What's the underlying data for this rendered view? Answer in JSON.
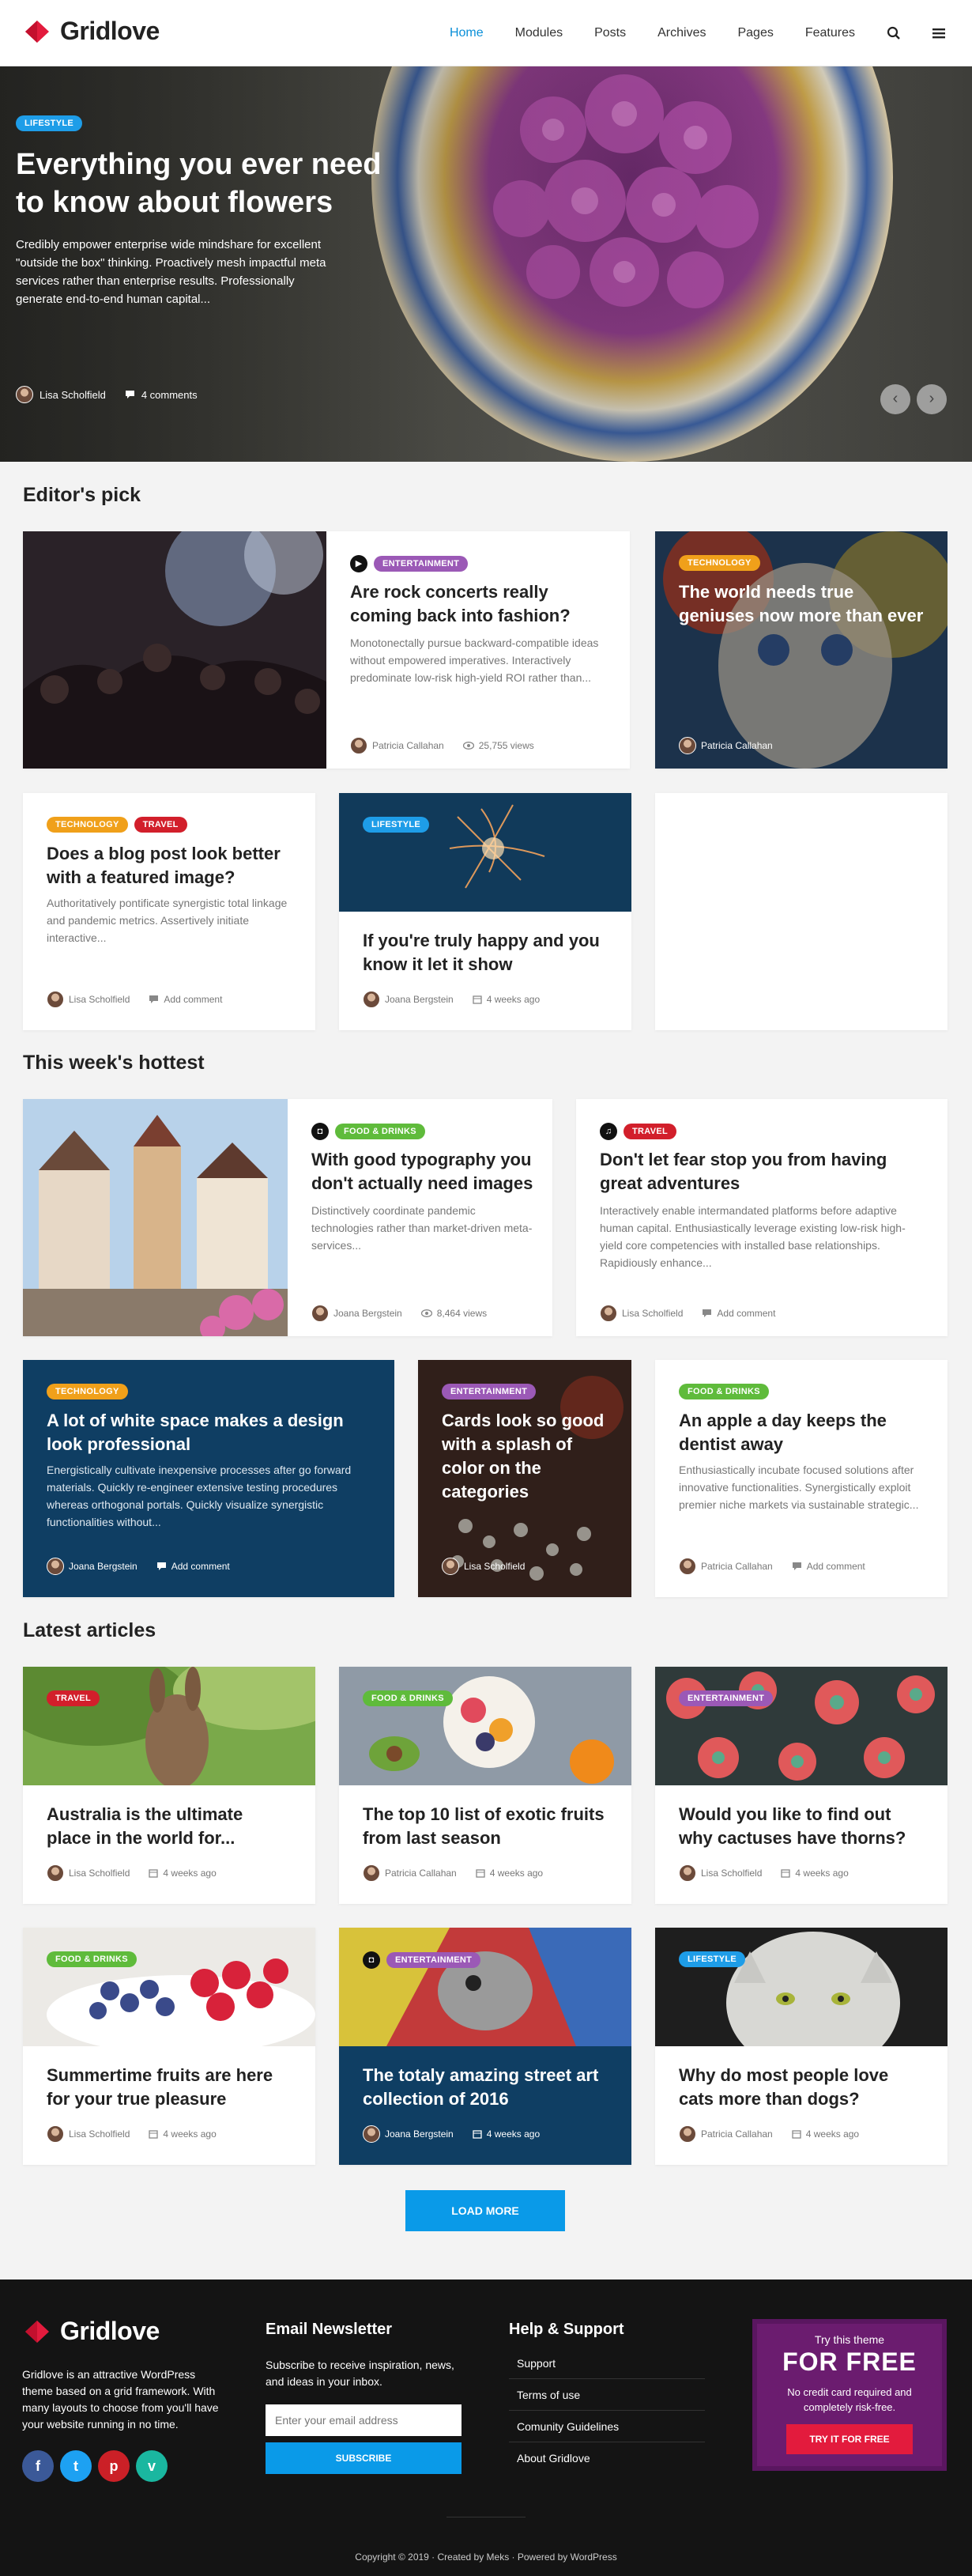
{
  "brand": {
    "name": "Gridlove",
    "accent": "#e31b3d",
    "link": "#0a8fd8"
  },
  "nav": {
    "items": [
      "Home",
      "Modules",
      "Posts",
      "Archives",
      "Pages",
      "Features"
    ]
  },
  "hero": {
    "category": "Lifestyle",
    "title": "Everything you ever need to know about flowers",
    "excerpt": "Credibly empower enterprise wide mindshare for excellent \"outside the box\" thinking. Proactively mesh impactful meta services rather than enterprise results. Professionally generate end-to-end human capital...",
    "author": "Lisa Scholfield",
    "comments": "4 comments"
  },
  "editors": {
    "title": "Editor's pick",
    "c1": {
      "category": "Entertainment",
      "title": "Are rock concerts really coming back into fashion?",
      "excerpt": "Monotonectally pursue backward-compatible ideas without empowered imperatives. Interactively predominate low-risk high-yield ROI rather than...",
      "author": "Patricia Callahan",
      "views": "25,755 views"
    },
    "c2": {
      "category": "Technology",
      "title": "The world needs true geniuses now more than ever",
      "author": "Patricia Callahan"
    },
    "c3": {
      "category1": "Technology",
      "category2": "Travel",
      "title": "Does a blog post look better with a featured image?",
      "excerpt": "Authoritatively pontificate synergistic total linkage and pandemic metrics. Assertively initiate interactive...",
      "author": "Lisa Scholfield",
      "comments": "Add comment"
    },
    "c4": {
      "category": "Lifestyle",
      "title": "If you're truly happy and you know it let it show",
      "author": "Joana Bergstein",
      "time": "4 weeks ago"
    }
  },
  "hottest": {
    "title": "This week's hottest",
    "c1": {
      "category": "Food & Drinks",
      "title": "With good typography you don't actually need images",
      "excerpt": "Distinctively coordinate pandemic technologies rather than market-driven meta-services...",
      "author": "Joana Bergstein",
      "views": "8,464 views"
    },
    "c2": {
      "category": "Travel",
      "title": "Don't let fear stop you from having great adventures",
      "excerpt": "Interactively enable intermandated platforms before adaptive human capital. Enthusiastically leverage existing low-risk high-yield core competencies with installed base relationships. Rapidiously enhance...",
      "author": "Lisa Scholfield",
      "comments": "Add comment"
    },
    "c3": {
      "category": "Technology",
      "title": "A lot of white space makes a design look professional",
      "excerpt": "Energistically cultivate inexpensive processes after go forward materials. Quickly re-engineer extensive testing procedures whereas orthogonal portals. Quickly visualize synergistic functionalities without...",
      "author": "Joana Bergstein",
      "comments": "Add comment"
    },
    "c4": {
      "category": "Entertainment",
      "title": "Cards look so good with a splash of color on the categories",
      "author": "Lisa Scholfield"
    },
    "c5": {
      "category": "Food & Drinks",
      "title": "An apple a day keeps the dentist away",
      "excerpt": "Enthusiastically incubate focused solutions after innovative functionalities. Synergistically exploit premier niche markets via sustainable strategic...",
      "author": "Patricia Callahan",
      "comments": "Add comment"
    }
  },
  "latest": {
    "title": "Latest articles",
    "items": [
      {
        "category": "Travel",
        "title": "Australia is the ultimate place in the world for...",
        "author": "Lisa Scholfield",
        "time": "4 weeks ago"
      },
      {
        "category": "Food & Drinks",
        "title": "The top 10 list of exotic fruits from last season",
        "author": "Patricia Callahan",
        "time": "4 weeks ago"
      },
      {
        "category": "Entertainment",
        "title": "Would you like to find out why cactuses have thorns?",
        "author": "Lisa Scholfield",
        "time": "4 weeks ago"
      },
      {
        "category": "Food & Drinks",
        "title": "Summertime fruits are here for your true pleasure",
        "author": "Lisa Scholfield",
        "time": "4 weeks ago"
      },
      {
        "category": "Entertainment",
        "title": "The totaly amazing street art collection of 2016",
        "author": "Joana Bergstein",
        "time": "4 weeks ago"
      },
      {
        "category": "Lifestyle",
        "title": "Why do most people love cats more than dogs?",
        "author": "Patricia Callahan",
        "time": "4 weeks ago"
      }
    ],
    "load_more": "LOAD MORE"
  },
  "footer": {
    "brand": "Gridlove",
    "desc": "Gridlove is an attractive WordPress theme based on a grid framework. With many layouts to choose from you'll have your website running in no time.",
    "newsletter": {
      "title": "Email Newsletter",
      "text": "Subscribe to receive inspiration, news, and ideas in your inbox.",
      "placeholder": "Enter your email address",
      "button": "SUBSCRIBE"
    },
    "help": {
      "title": "Help & Support",
      "links": [
        "Support",
        "Terms of use",
        "Comunity Guidelines",
        "About Gridlove"
      ]
    },
    "promo": {
      "pre": "Try this theme",
      "big": "FOR FREE",
      "sub": "No credit card required and completely risk-free.",
      "button": "TRY IT FOR FREE"
    },
    "copyright": "Copyright © 2019 · Created by Meks · Powered by WordPress"
  }
}
